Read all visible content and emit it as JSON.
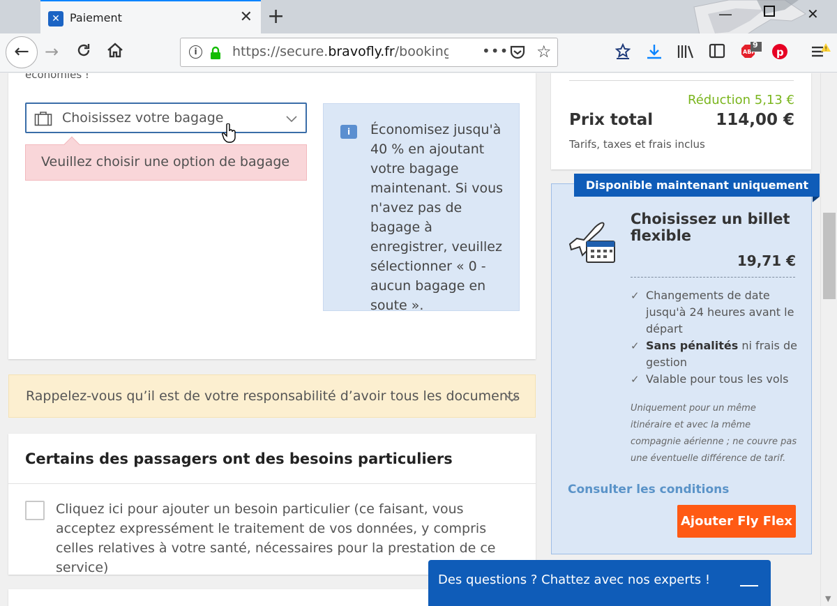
{
  "browser": {
    "tab_title": "Paiement",
    "tab_favicon": "bravofly-favicon",
    "url_scheme": "https://secure.",
    "url_domain": "bravofly.fr",
    "url_path": "/booking/fl",
    "url_dots": "•••",
    "addon_badge": "9",
    "icons": [
      "back-icon",
      "forward-icon",
      "reload-icon",
      "home-icon",
      "info-icon",
      "lock-icon",
      "pocket-icon",
      "star-icon",
      "bookmark-star-icon",
      "download-icon",
      "library-icon",
      "sidebar-icon",
      "adblock-icon",
      "pinterest-icon",
      "menu-icon"
    ]
  },
  "baggage": {
    "savings_text": "économies !",
    "select_placeholder": "Choisissez votre bagage",
    "error_text": "Veuillez choisir une option de bagage",
    "info_text": "Économisez jusqu'à 40 % en ajoutant votre bagage maintenant. Si vous n'avez pas de bagage à enregistrer, veuillez sélectionner « 0 - aucun bagage en soute »."
  },
  "reminder": {
    "text": "Rappelez-vous qu’il est de votre responsabilité d’avoir tous les documents"
  },
  "needs": {
    "title": "Certains des passagers ont des besoins particuliers",
    "checkbox_text": "Cliquez ici pour ajouter un besoin particulier (ce faisant, vous acceptez expressément le traitement de vos données, y compris celles relatives à votre santé, nécessaires pour la prestation de ce service)"
  },
  "summary": {
    "reduction": "Réduction 5,13 €",
    "total_label": "Prix total",
    "total_value": "114,00 €",
    "tax_note": "Tarifs, taxes et frais inclus"
  },
  "flex": {
    "banner": "Disponible maintenant uniquement",
    "title": "Choisissez un billet flexible",
    "price": "19,71 €",
    "feature_1": "Changements de date jusqu'à 24 heures avant le départ",
    "feature_2_bold": "Sans pénalités",
    "feature_2_rest": " ni frais de gestion",
    "feature_3": "Valable pour tous les vols",
    "note": "Uniquement pour un même itinéraire et avec la même compagnie aérienne ; ne couvre pas une éventuelle différence de tarif.",
    "link": "Consulter les conditions",
    "button": "Ajouter Fly Flex"
  },
  "chat": {
    "text": "Des questions ? Chattez avec nos experts !"
  },
  "colors": {
    "primary_blue": "#0f5cb8",
    "cta_orange": "#ff5a14",
    "reduction_green": "#7ab51d",
    "error_bg": "#f9d6d9",
    "info_bg": "#dbe7f6",
    "warning_bg": "#fcefd0"
  }
}
